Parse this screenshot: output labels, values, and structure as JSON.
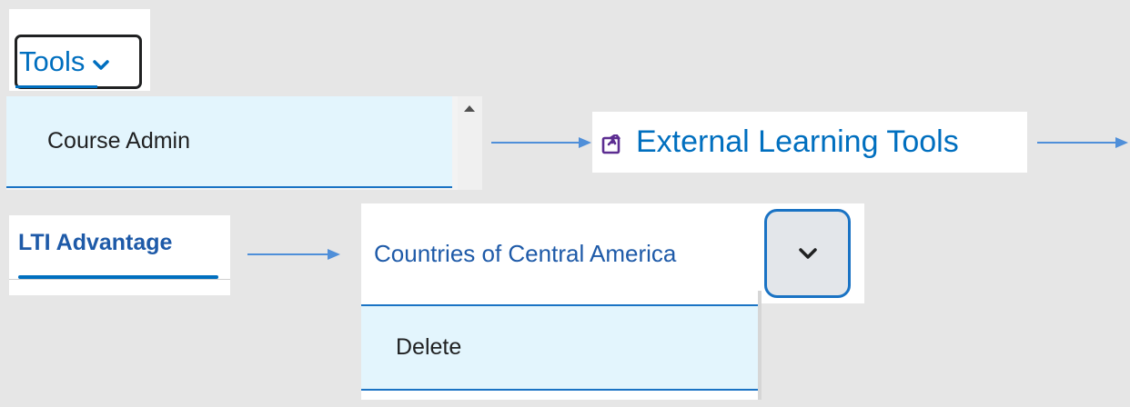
{
  "tools": {
    "label": "Tools",
    "icon": "chevron-down-icon"
  },
  "menu": {
    "course_admin": "Course Admin",
    "scroll_icon": "scroll-up-arrow-icon"
  },
  "external": {
    "label": "External Learning Tools",
    "icon": "external-tool-icon",
    "icon_color": "#5c2d91"
  },
  "lti": {
    "tab_label": "LTI Advantage"
  },
  "context": {
    "item_title": "Countries of Central America",
    "options_icon": "chevron-down-icon"
  },
  "actions": {
    "delete_label": "Delete"
  },
  "colors": {
    "accent": "#006fbf",
    "arrow": "#4f8fd9",
    "highlight": "#e3f5fd",
    "background": "#e6e6e6"
  }
}
